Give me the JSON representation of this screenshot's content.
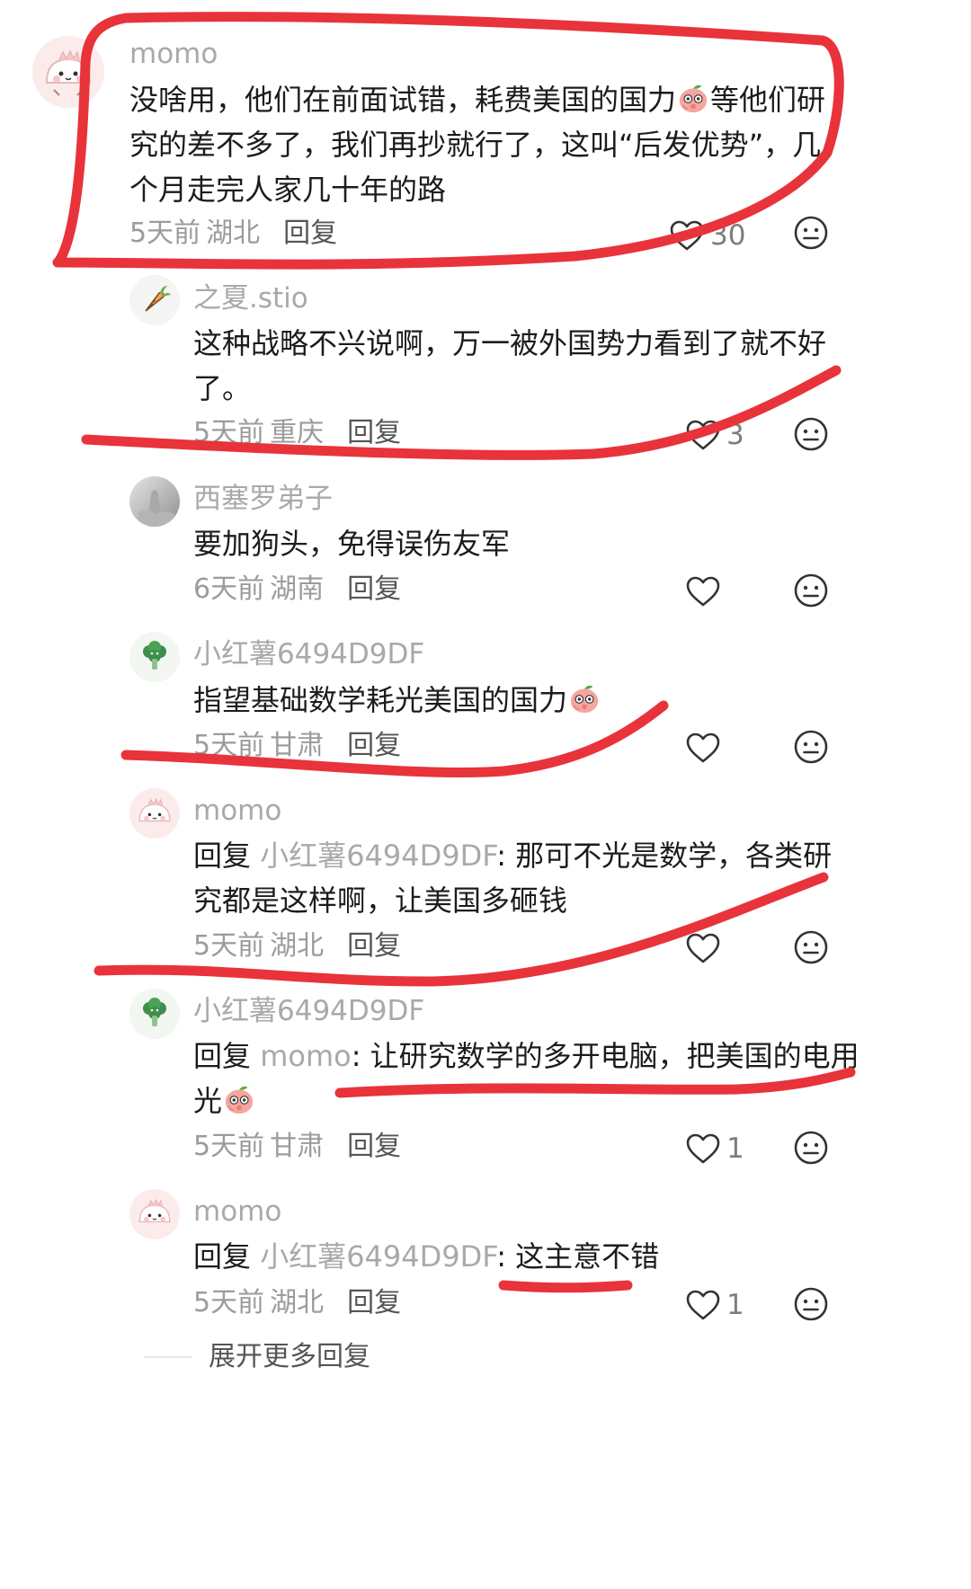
{
  "comments": [
    {
      "username": "momo",
      "lines": [
        "没啥用，他们在前面试错，耗费美国的国力",
        "等他们研",
        "究的差不多了，我们再抄就行了，这叫“后发优势”，几",
        "个月走完人家几十年的路"
      ],
      "time": "5天前",
      "location": "湖北",
      "reply": "回复",
      "likes": "30"
    },
    {
      "username": "之夏.stio",
      "lines": [
        "这种战略不兴说啊，万一被外国势力看到了就不好",
        "了。"
      ],
      "time": "5天前",
      "location": "重庆",
      "reply": "回复",
      "likes": "3"
    },
    {
      "username": "西塞罗弟子",
      "lines": [
        "要加狗头，免得误伤友军"
      ],
      "time": "6天前",
      "location": "湖南",
      "reply": "回复",
      "likes": ""
    },
    {
      "username": "小红薯6494D9DF",
      "lines": [
        "指望基础数学耗光美国的国力"
      ],
      "time": "5天前",
      "location": "甘肃",
      "reply": "回复",
      "likes": ""
    },
    {
      "username": "momo",
      "reply_prefix": "回复 ",
      "mention": "小红薯6494D9DF",
      "lines": [
        ": 那可不光是数学，各类研",
        "究都是这样啊，让美国多砸钱"
      ],
      "time": "5天前",
      "location": "湖北",
      "reply": "回复",
      "likes": ""
    },
    {
      "username": "小红薯6494D9DF",
      "reply_prefix": "回复 ",
      "mention": "momo",
      "lines": [
        ": 让研究数学的多开电脑，把美国的电用",
        "光"
      ],
      "time": "5天前",
      "location": "甘肃",
      "reply": "回复",
      "likes": "1"
    },
    {
      "username": "momo",
      "reply_prefix": "回复 ",
      "mention": "小红薯6494D9DF",
      "lines": [
        ": 这主意不错"
      ],
      "time": "5天前",
      "location": "湖北",
      "reply": "回复",
      "likes": "1"
    }
  ],
  "expand_more": "展开更多回复",
  "icons": {
    "heart": "heart-icon",
    "face": "neutral-face-icon",
    "emoji": "peach-sticker-emoji",
    "avatar_momo": "pink-cartoon-avatar",
    "avatar_carrot": "carrot-avatar",
    "avatar_photo": "grey-photo-avatar",
    "avatar_broccoli": "broccoli-avatar"
  },
  "colors": {
    "annotation": "#e8333b",
    "username": "#a9a9a9",
    "text": "#1c1c1c",
    "meta": "#9b9b9b"
  }
}
